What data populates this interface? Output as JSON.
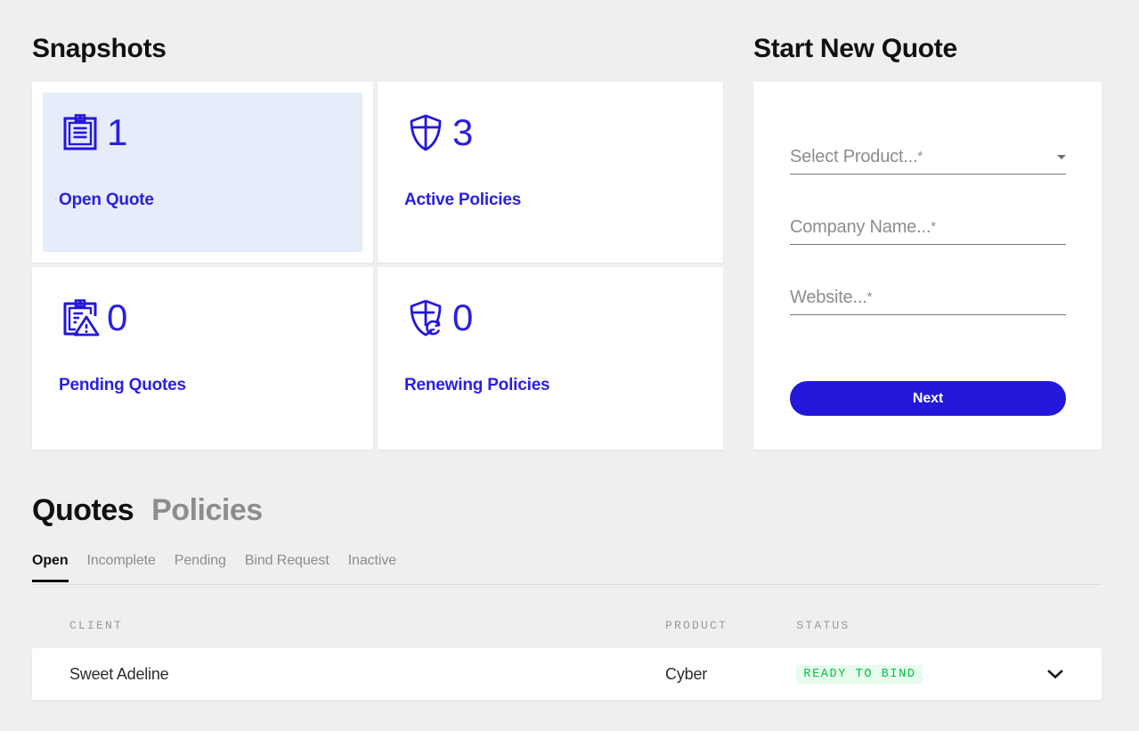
{
  "snapshots": {
    "heading": "Snapshots",
    "cards": [
      {
        "icon": "clipboard-list-icon",
        "count": "1",
        "label": "Open Quote",
        "selected": true
      },
      {
        "icon": "shield-check-icon",
        "count": "3",
        "label": "Active Policies",
        "selected": false
      },
      {
        "icon": "clipboard-warning-icon",
        "count": "0",
        "label": "Pending Quotes",
        "selected": false
      },
      {
        "icon": "shield-renew-icon",
        "count": "0",
        "label": "Renewing Policies",
        "selected": false
      }
    ]
  },
  "new_quote": {
    "heading": "Start New Quote",
    "fields": [
      {
        "name": "product",
        "placeholder": "Select Product...",
        "required_mark": "*",
        "value": "",
        "type": "select"
      },
      {
        "name": "company",
        "placeholder": "Company Name...",
        "required_mark": "*",
        "value": "",
        "type": "text"
      },
      {
        "name": "website",
        "placeholder": "Website...",
        "required_mark": "*",
        "value": "",
        "type": "text"
      }
    ],
    "submit_label": "Next"
  },
  "records": {
    "primary_tabs": [
      {
        "label": "Quotes",
        "active": true
      },
      {
        "label": "Policies",
        "active": false
      }
    ],
    "sub_tabs": [
      {
        "label": "Open",
        "active": true
      },
      {
        "label": "Incomplete",
        "active": false
      },
      {
        "label": "Pending",
        "active": false
      },
      {
        "label": "Bind Request",
        "active": false
      },
      {
        "label": "Inactive",
        "active": false
      }
    ],
    "columns": [
      "CLIENT",
      "PRODUCT",
      "STATUS"
    ],
    "rows": [
      {
        "client": "Sweet Adeline",
        "product": "Cyber",
        "status": "READY TO BIND"
      }
    ]
  },
  "colors": {
    "brand_blue": "#2317d9",
    "selected_card_bg": "#e6ecf9",
    "status_green_text": "#00c43c",
    "status_green_bg": "#e8fbef",
    "page_bg": "#efefef"
  }
}
